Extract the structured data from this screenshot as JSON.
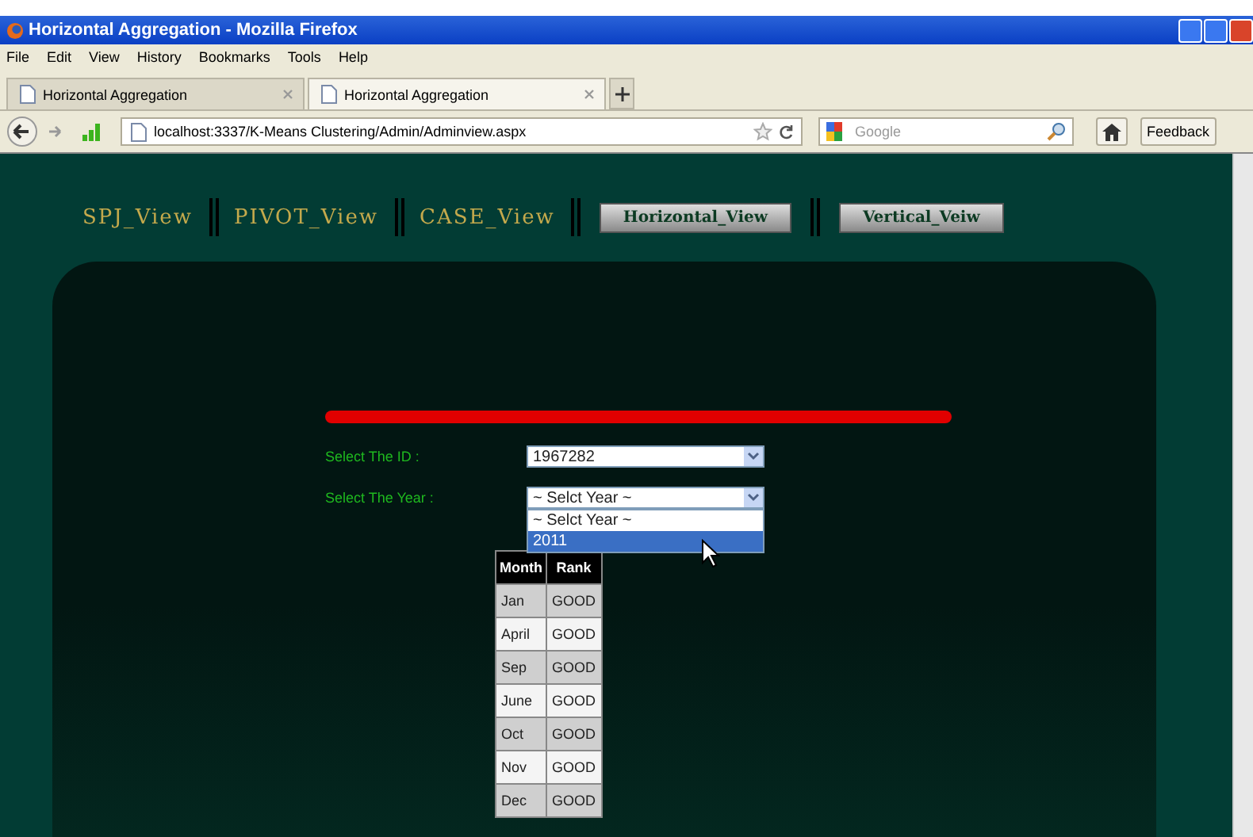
{
  "window": {
    "title": "Horizontal Aggregation - Mozilla Firefox"
  },
  "menu": [
    "File",
    "Edit",
    "View",
    "History",
    "Bookmarks",
    "Tools",
    "Help"
  ],
  "tabs": [
    {
      "label": "Horizontal Aggregation",
      "selected": false
    },
    {
      "label": "Horizontal Aggregation",
      "selected": true
    }
  ],
  "address": {
    "url": "localhost:3337/K-Means Clustering/Admin/Adminview.aspx"
  },
  "search": {
    "placeholder": "Google"
  },
  "feedback": "Feedback",
  "nav": [
    {
      "label": "SPJ_View",
      "kind": "link"
    },
    {
      "label": "PIVOT_View",
      "kind": "link"
    },
    {
      "label": "CASE_View",
      "kind": "link"
    },
    {
      "label": "Horizontal_View",
      "kind": "button"
    },
    {
      "label": "Vertical_Veiw",
      "kind": "button"
    }
  ],
  "form": {
    "id_label": "Select The ID :",
    "id_value": "1967282",
    "year_label": "Select The Year :",
    "year_value": "~ Selct Year ~",
    "year_options": [
      {
        "label": "~ Selct Year ~",
        "selected": false
      },
      {
        "label": "2011",
        "selected": true
      }
    ]
  },
  "table": {
    "columns": [
      "Month",
      "Rank"
    ],
    "rows": [
      [
        "Jan",
        "GOOD"
      ],
      [
        "April",
        "GOOD"
      ],
      [
        "Sep",
        "GOOD"
      ],
      [
        "June",
        "GOOD"
      ],
      [
        "Oct",
        "GOOD"
      ],
      [
        "Nov",
        "GOOD"
      ],
      [
        "Dec",
        "GOOD"
      ]
    ]
  }
}
